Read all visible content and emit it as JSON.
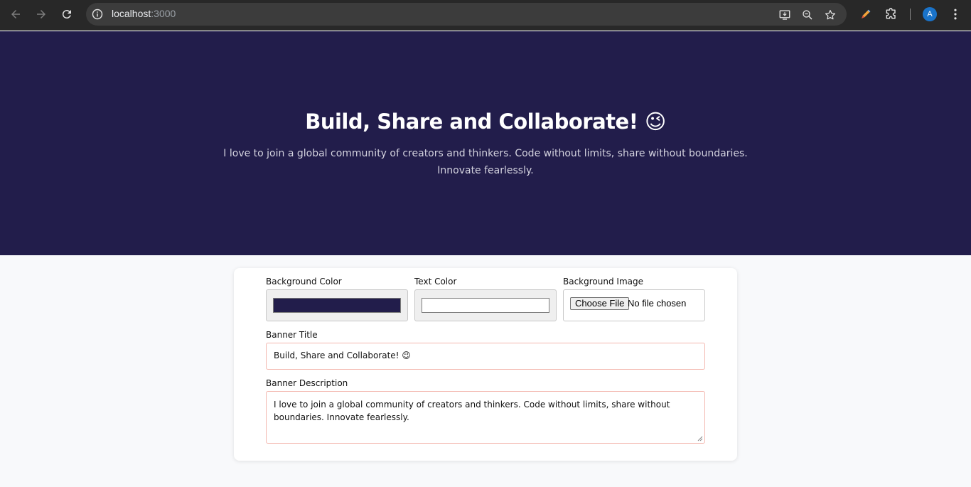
{
  "browser": {
    "url_host": "localhost",
    "url_port": ":3000",
    "avatar_letter": "A",
    "icons": [
      "back-icon",
      "forward-icon",
      "reload-icon",
      "site-info-icon",
      "install-app-icon",
      "zoom-icon",
      "bookmark-star-icon",
      "pen-extension-icon",
      "extensions-puzzle-icon",
      "menu-kebab-icon"
    ]
  },
  "banner": {
    "title": "Build, Share and Collaborate! 😉",
    "description": "I love to join a global community of creators and thinkers. Code without limits, share without boundaries. Innovate fearlessly.",
    "background_color": "#221d4b",
    "text_color": "#ffffff"
  },
  "form": {
    "bg_color_label": "Background Color",
    "text_color_label": "Text Color",
    "bg_image_label": "Background Image",
    "choose_file_label": "Choose File",
    "file_status": "No file chosen",
    "title_label": "Banner Title",
    "title_value": "Build, Share and Collaborate! 😉",
    "description_label": "Banner Description",
    "description_value": "I love to join a global community of creators and thinkers. Code without limits, share without boundaries. Innovate fearlessly."
  }
}
